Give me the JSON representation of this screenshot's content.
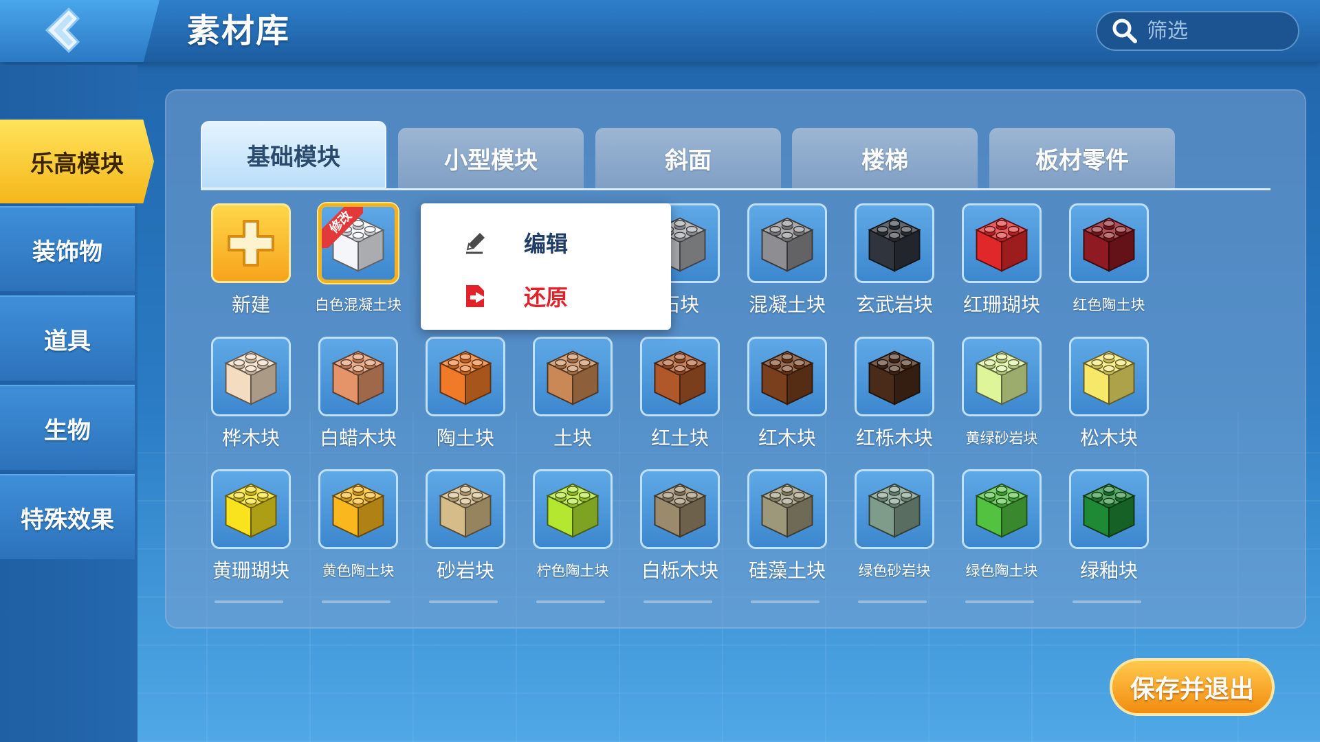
{
  "header": {
    "title": "素材库",
    "search_placeholder": "筛选"
  },
  "sidebar": {
    "items": [
      {
        "label": "乐高模块",
        "active": true
      },
      {
        "label": "装饰物",
        "active": false
      },
      {
        "label": "道具",
        "active": false
      },
      {
        "label": "生物",
        "active": false
      },
      {
        "label": "特殊效果",
        "active": false
      }
    ]
  },
  "tabs": [
    {
      "label": "基础模块",
      "active": true
    },
    {
      "label": "小型模块",
      "active": false
    },
    {
      "label": "斜面",
      "active": false
    },
    {
      "label": "楼梯",
      "active": false
    },
    {
      "label": "板材零件",
      "active": false
    }
  ],
  "new_item_label": "新建",
  "modified_badge": "修改",
  "blocks_row1": [
    {
      "label": "白色混凝土块",
      "color": "#f4f6fa",
      "small": true,
      "selected": true
    },
    {
      "label": "混凝土块",
      "color": "#8e8e92"
    },
    {
      "label": "玄武岩块",
      "color": "#30353d"
    },
    {
      "label": "红珊瑚块",
      "color": "#e0282a"
    },
    {
      "label": "红色陶土块",
      "color": "#8f1a22",
      "small": true
    }
  ],
  "partial_label": "石块",
  "blocks_row2": [
    {
      "label": "桦木块",
      "color": "#f3dcc0"
    },
    {
      "label": "白蜡木块",
      "color": "#e5946a"
    },
    {
      "label": "陶土块",
      "color": "#f07a28"
    },
    {
      "label": "土块",
      "color": "#c98855"
    },
    {
      "label": "红土块",
      "color": "#b0582a"
    },
    {
      "label": "红木块",
      "color": "#7a3f1c"
    },
    {
      "label": "红栎木块",
      "color": "#4a2a18"
    },
    {
      "label": "黄绿砂岩块",
      "color": "#def59a",
      "small": true
    },
    {
      "label": "松木块",
      "color": "#f7e86a"
    }
  ],
  "blocks_row3": [
    {
      "label": "黄珊瑚块",
      "color": "#f9e21e"
    },
    {
      "label": "黄色陶土块",
      "color": "#fbb81e",
      "small": true
    },
    {
      "label": "砂岩块",
      "color": "#d6bc88"
    },
    {
      "label": "柠色陶土块",
      "color": "#b4e830",
      "small": true
    },
    {
      "label": "白栎木块",
      "color": "#9c8a6c"
    },
    {
      "label": "硅藻土块",
      "color": "#9d987a"
    },
    {
      "label": "绿色砂岩块",
      "color": "#7f9c8a",
      "small": true
    },
    {
      "label": "绿色陶土块",
      "color": "#52c240",
      "small": true
    },
    {
      "label": "绿釉块",
      "color": "#1f8a35"
    }
  ],
  "context_menu": {
    "edit_label": "编辑",
    "restore_label": "还原",
    "restore_color": "#e0232a"
  },
  "save_button": "保存并退出"
}
